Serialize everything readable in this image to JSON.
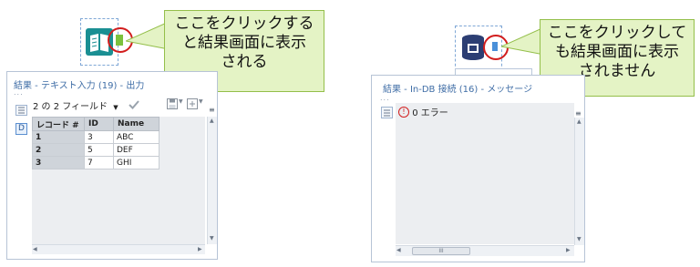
{
  "left": {
    "callout_text": "ここをクリックする\nと結果画面に表示\nされる",
    "panel": {
      "title": "結果 - テキスト入力 (19) - 出力",
      "grip": "...",
      "field_selector": "2 の 2 フィールド",
      "table": {
        "headers": [
          "レコード #",
          "ID",
          "Name"
        ],
        "rows": [
          [
            "1",
            "3",
            "ABC"
          ],
          [
            "2",
            "5",
            "DEF"
          ],
          [
            "3",
            "7",
            "GHI"
          ]
        ]
      }
    }
  },
  "right": {
    "callout_text": "ここをクリックして\nも結果画面に表示\nされません",
    "panel": {
      "title": "結果 - In-DB 接続 (16) - メッセージ",
      "grip": "...",
      "error_text": "0 エラー",
      "scroll_grip": "III"
    }
  },
  "colors": {
    "callout_bg": "#e4f3c5",
    "callout_border": "#94bf4a",
    "highlight_ring": "#d21d1d",
    "tool_teal": "#1a8f93",
    "anchor_green": "#7cc13d",
    "anchor_blue": "#4a90d9"
  }
}
